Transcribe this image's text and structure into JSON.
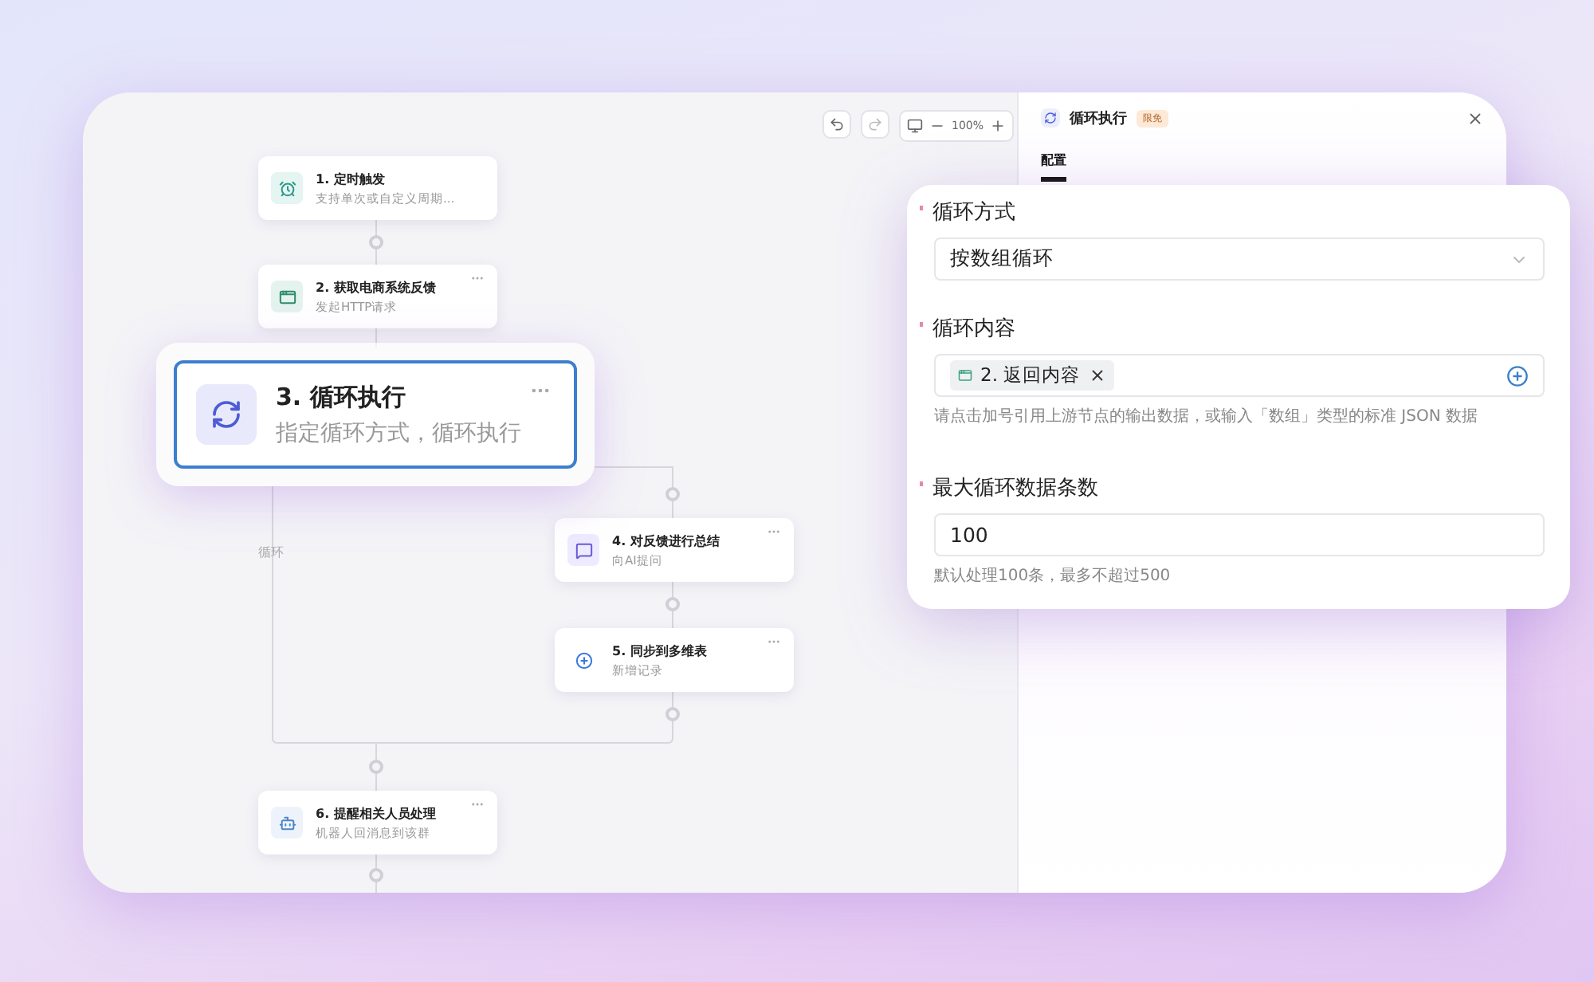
{
  "toolbar": {
    "zoom": "100%"
  },
  "canvas": {
    "loop_label": "循环",
    "nodes": [
      {
        "title": "1. 定时触发",
        "subtitle": "支持单次或自定义周期...",
        "kind": "timer",
        "menu": false,
        "selected": false
      },
      {
        "title": "2. 获取电商系统反馈",
        "subtitle": "发起HTTP请求",
        "kind": "http",
        "menu": true,
        "selected": false
      },
      {
        "title": "3. 循环执行",
        "subtitle": "指定循环方式，循环执行",
        "kind": "loop",
        "menu": true,
        "selected": true
      },
      {
        "title": "4. 对反馈进行总结",
        "subtitle": "向AI提问",
        "kind": "ai",
        "menu": true,
        "selected": false
      },
      {
        "title": "5. 同步到多维表",
        "subtitle": "新增记录",
        "kind": "table",
        "menu": true,
        "selected": false
      },
      {
        "title": "6. 提醒相关人员处理",
        "subtitle": "机器人回消息到该群",
        "kind": "bot",
        "menu": true,
        "selected": false
      }
    ]
  },
  "panel": {
    "title": "循环执行",
    "badge": "限免",
    "tabs": [
      {
        "label": "配置",
        "selected": true
      }
    ]
  },
  "form": {
    "fields": [
      {
        "label": "循环方式",
        "required": true,
        "kind": "select",
        "value": "按数组循环"
      },
      {
        "label": "循环内容",
        "required": true,
        "kind": "tags",
        "tags": [
          "2. 返回内容"
        ],
        "hint": "请点击加号引用上游节点的输出数据，或输入「数组」类型的标准 JSON 数据"
      },
      {
        "label": "最大循环数据条数",
        "required": true,
        "kind": "input",
        "value": "100",
        "hint": "默认处理100条，最多不超过500"
      }
    ]
  }
}
